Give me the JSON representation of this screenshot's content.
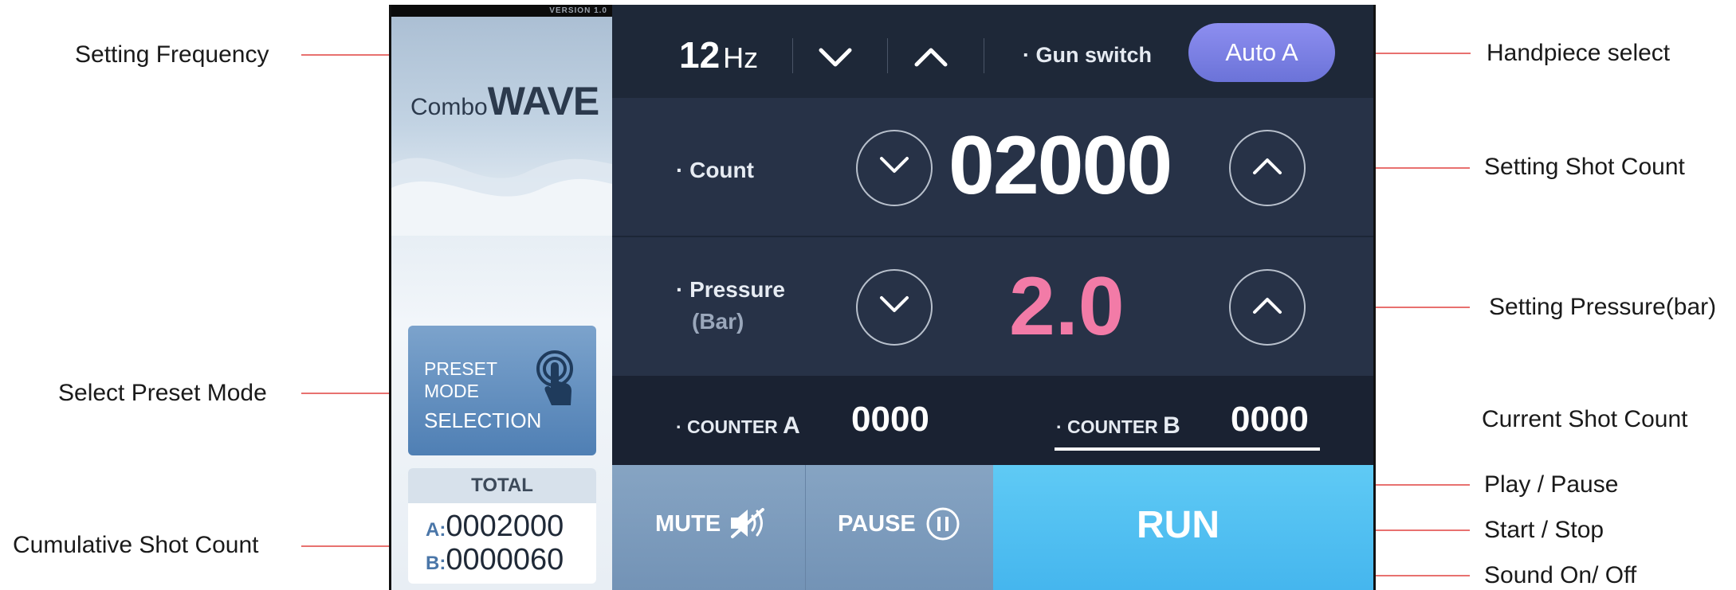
{
  "annotations": {
    "setting_frequency": "Setting Frequency",
    "select_preset_mode": "Select Preset Mode",
    "cumulative_shot_count": "Cumulative Shot Count",
    "handpiece_select": "Handpiece select",
    "setting_shot_count": "Setting Shot Count",
    "setting_pressure": "Setting Pressure(bar)",
    "current_shot_count": "Current Shot Count",
    "play_pause": "Play / Pause",
    "start_stop": "Start / Stop",
    "sound_on_off": "Sound On/ Off"
  },
  "sidebar": {
    "version": "VERSION 1.0",
    "logo_small": "Combo",
    "logo_big": "WAVE",
    "preset_line1": "PRESET",
    "preset_line2": "MODE",
    "preset_line3": "SELECTION",
    "total_header": "TOTAL",
    "total_a_key": "A:",
    "total_a_value": "0002000",
    "total_b_key": "B:",
    "total_b_value": "0000060"
  },
  "header": {
    "frequency_value": "12",
    "frequency_unit": "Hz",
    "gun_switch_label": "· Gun switch",
    "handpiece_button": "Auto A"
  },
  "count": {
    "label": "· Count",
    "value": "02000"
  },
  "pressure": {
    "label": "· Pressure",
    "unit": "(Bar)",
    "value": "2.0"
  },
  "counters": {
    "a_prefix": "· COUNTER",
    "a_letter": "A",
    "a_value": "0000",
    "b_prefix": "· COUNTER",
    "b_letter": "B",
    "b_value": "0000"
  },
  "controls": {
    "mute": "MUTE",
    "pause": "PAUSE",
    "run": "RUN"
  },
  "colors": {
    "accent_pink": "#f27ba7",
    "run_blue": "#45b6ee",
    "auto_purple": "#7b80e2",
    "leader": "#e8716f"
  }
}
